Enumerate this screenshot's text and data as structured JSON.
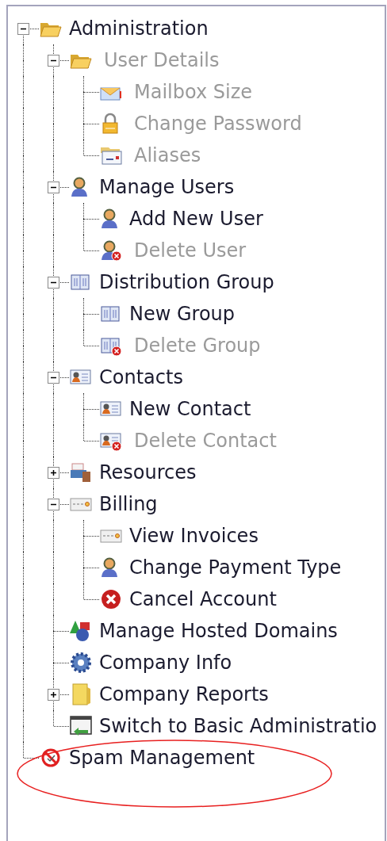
{
  "tree": [
    {
      "label": "Administration",
      "kind": "folder",
      "disabled": false,
      "expanded": true,
      "children": [
        {
          "label": "User Details",
          "kind": "folder",
          "disabled": true,
          "expanded": true,
          "children": [
            {
              "label": "Mailbox Size",
              "kind": "mail",
              "disabled": true
            },
            {
              "label": "Change Password",
              "kind": "lock",
              "disabled": true
            },
            {
              "label": "Aliases",
              "kind": "aliases",
              "disabled": true
            }
          ]
        },
        {
          "label": "Manage Users",
          "kind": "user",
          "disabled": false,
          "expanded": true,
          "children": [
            {
              "label": "Add New User",
              "kind": "user",
              "disabled": false
            },
            {
              "label": "Delete User",
              "kind": "user-delete",
              "disabled": true
            }
          ]
        },
        {
          "label": "Distribution Group",
          "kind": "group",
          "disabled": false,
          "expanded": true,
          "children": [
            {
              "label": "New Group",
              "kind": "group",
              "disabled": false
            },
            {
              "label": "Delete Group",
              "kind": "group-delete",
              "disabled": true
            }
          ]
        },
        {
          "label": "Contacts",
          "kind": "contact",
          "disabled": false,
          "expanded": true,
          "children": [
            {
              "label": "New Contact",
              "kind": "contact",
              "disabled": false
            },
            {
              "label": "Delete Contact",
              "kind": "contact-delete",
              "disabled": true
            }
          ]
        },
        {
          "label": "Resources",
          "kind": "resources",
          "disabled": false,
          "expanded": false
        },
        {
          "label": "Billing",
          "kind": "billing",
          "disabled": false,
          "expanded": true,
          "children": [
            {
              "label": "View Invoices",
              "kind": "billing",
              "disabled": false
            },
            {
              "label": "Change Payment Type",
              "kind": "user",
              "disabled": false
            },
            {
              "label": "Cancel Account",
              "kind": "cancel",
              "disabled": false
            }
          ]
        },
        {
          "label": "Manage Hosted Domains",
          "kind": "domains",
          "disabled": false
        },
        {
          "label": "Company Info",
          "kind": "gear",
          "disabled": false
        },
        {
          "label": "Company Reports",
          "kind": "reports",
          "disabled": false,
          "expanded": false
        },
        {
          "label": "Switch to Basic Administratio",
          "kind": "switch",
          "disabled": false
        }
      ]
    },
    {
      "label": "Spam Management",
      "kind": "spam",
      "disabled": false
    }
  ]
}
